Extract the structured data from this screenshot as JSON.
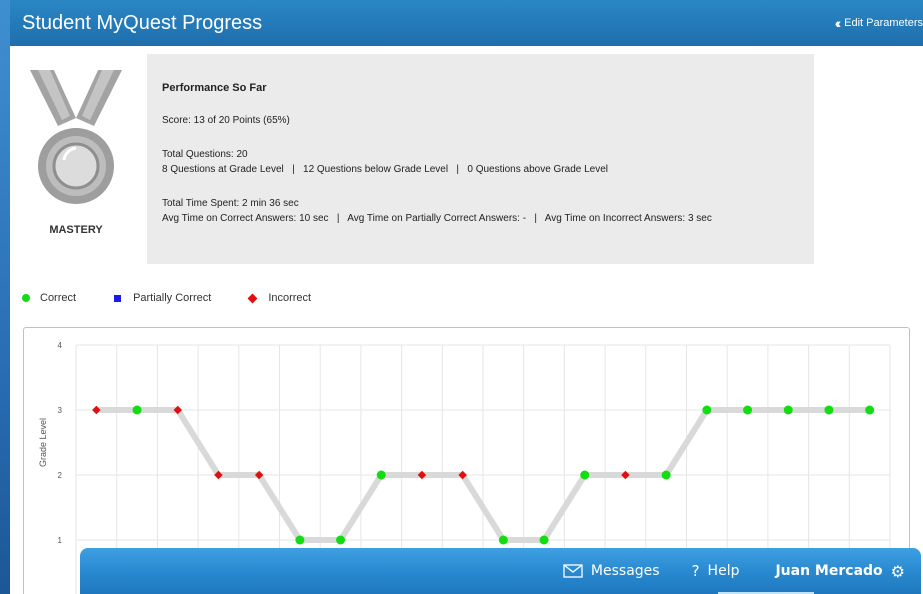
{
  "header": {
    "title": "Student MyQuest Progress",
    "edit_params": "Edit Parameters"
  },
  "medal": {
    "label": "MASTERY"
  },
  "performance": {
    "title": "Performance So Far",
    "score": "Score: 13 of 20 Points (65%)",
    "total_questions": "Total Questions: 20",
    "questions_breakdown": "8 Questions at Grade Level   |   12 Questions below Grade Level   |   0 Questions above Grade Level",
    "total_time": "Total Time Spent: 2 min 36 sec",
    "avg_times": "Avg Time on Correct Answers: 10 sec   |   Avg Time on Partially Correct Answers: -   |   Avg Time on Incorrect Answers: 3 sec"
  },
  "legend": {
    "correct": "Correct",
    "partial": "Partially Correct",
    "incorrect": "Incorrect"
  },
  "colors": {
    "correct": "#11dd11",
    "partial": "#1a1aee",
    "incorrect": "#e11010",
    "line": "#d9d9d9",
    "header": "#1e6fac"
  },
  "chart_data": {
    "type": "line",
    "ylabel": "Grade Level",
    "ylim": [
      1,
      4
    ],
    "yticks": [
      "1",
      "2",
      "3",
      "4"
    ],
    "x": [
      1,
      2,
      3,
      4,
      5,
      6,
      7,
      8,
      9,
      10,
      11,
      12,
      13,
      14,
      15,
      16,
      17,
      18,
      19,
      20
    ],
    "values": [
      3,
      3,
      3,
      2,
      2,
      1,
      1,
      2,
      2,
      2,
      1,
      1,
      2,
      2,
      2,
      3,
      3,
      3,
      3,
      3
    ],
    "results": [
      "incorrect",
      "correct",
      "incorrect",
      "incorrect",
      "incorrect",
      "correct",
      "correct",
      "correct",
      "incorrect",
      "incorrect",
      "correct",
      "correct",
      "correct",
      "incorrect",
      "correct",
      "correct",
      "correct",
      "correct",
      "correct",
      "correct"
    ],
    "grid": true
  },
  "taskbar": {
    "messages": "Messages",
    "help": "Help",
    "user": "Juan Mercado"
  }
}
